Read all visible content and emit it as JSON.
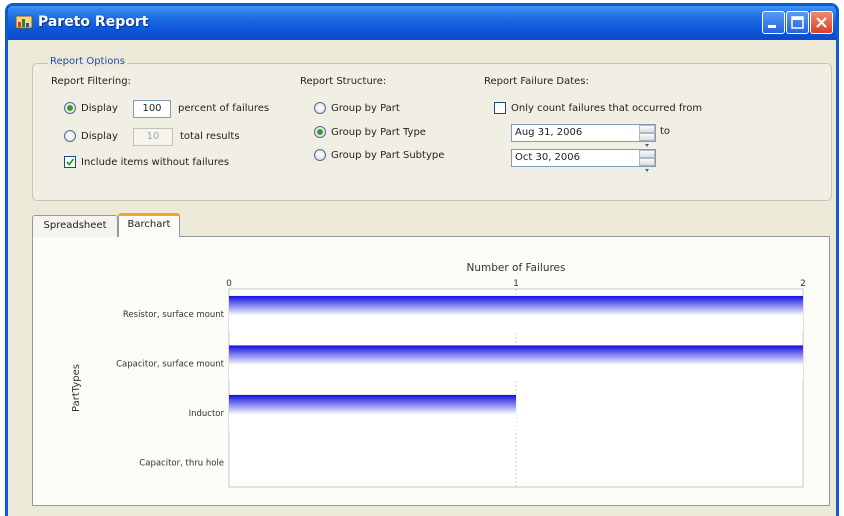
{
  "window": {
    "title": "Pareto Report"
  },
  "options": {
    "legend": "Report Options",
    "filtering": {
      "heading": "Report Filtering:",
      "display_percent": {
        "prefix": "Display",
        "value": "100",
        "suffix": "percent of failures",
        "selected": true
      },
      "display_total": {
        "prefix": "Display",
        "value": "10",
        "suffix": "total results",
        "selected": false
      },
      "include_items": {
        "label": "Include items without failures",
        "checked": true
      }
    },
    "structure": {
      "heading": "Report Structure:",
      "options": [
        {
          "label": "Group by Part",
          "selected": false
        },
        {
          "label": "Group by Part Type",
          "selected": true
        },
        {
          "label": "Group by Part Subtype",
          "selected": false
        }
      ]
    },
    "dates": {
      "heading": "Report Failure Dates:",
      "only_count": {
        "label": "Only count failures that occurred from",
        "checked": false
      },
      "from": "Aug 31, 2006",
      "to_label": "to",
      "to": "Oct 30, 2006"
    }
  },
  "tabs": [
    {
      "label": "Spreadsheet",
      "active": false
    },
    {
      "label": "Barchart",
      "active": true
    }
  ],
  "chart_data": {
    "type": "bar",
    "orientation": "horizontal",
    "title": "Number of Failures",
    "ylabel": "PartTypes",
    "categories": [
      "Resistor, surface mount",
      "Capacitor, surface mount",
      "Inductor",
      "Capacitor, thru hole"
    ],
    "values": [
      2,
      2,
      1,
      0
    ],
    "xlim": [
      0,
      2
    ],
    "xticks": [
      0,
      1,
      2
    ],
    "grid": true,
    "colors": {
      "bar_edge": "#1010e0",
      "bar_mid": "#ffffff"
    }
  }
}
